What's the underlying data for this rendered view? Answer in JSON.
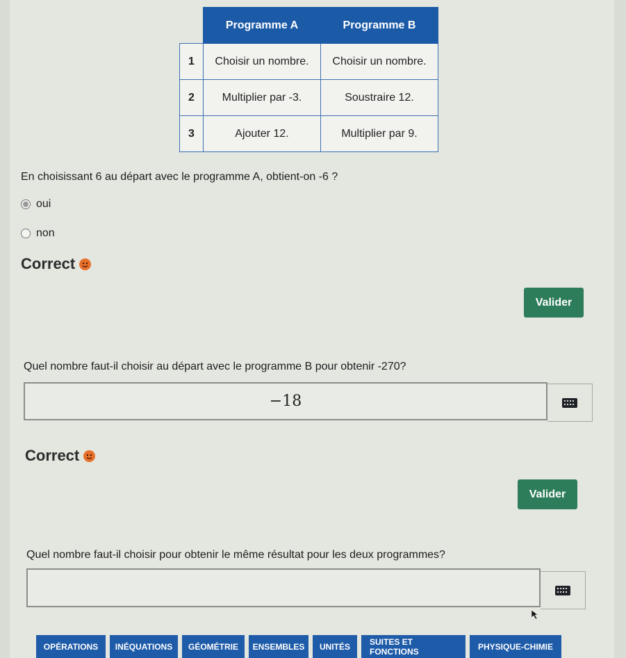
{
  "table": {
    "headers": [
      "Programme A",
      "Programme B"
    ],
    "rows": [
      {
        "num": "1",
        "a": "Choisir un nombre.",
        "b": "Choisir un nombre."
      },
      {
        "num": "2",
        "a": "Multiplier par -3.",
        "b": "Soustraire 12."
      },
      {
        "num": "3",
        "a": "Ajouter 12.",
        "b": "Multiplier par 9."
      }
    ]
  },
  "q1": {
    "text": "En choisissant 6 au départ avec le programme A, obtient-on -6 ?",
    "options": [
      "oui",
      "non"
    ],
    "selected": "oui",
    "feedback": "Correct",
    "submit_label": "Valider"
  },
  "q2": {
    "text": "Quel nombre faut-il choisir au départ avec le programme B pour obtenir -270?",
    "answer": "−18",
    "feedback": "Correct",
    "submit_label": "Valider"
  },
  "q3": {
    "text": "Quel nombre faut-il choisir pour obtenir le même résultat pour les deux programmes?",
    "answer": ""
  },
  "tabs": [
    "OPÉRATIONS",
    "INÉQUATIONS",
    "GÉOMÉTRIE",
    "ENSEMBLES",
    "UNITÉS",
    "SUITES ET FONCTIONS",
    "PHYSIQUE-CHIMIE"
  ],
  "colors": {
    "table_header": "#1b5aa6",
    "valider": "#2e7d5a",
    "tab": "#1e5ba8",
    "smiley": "#e8702a"
  }
}
